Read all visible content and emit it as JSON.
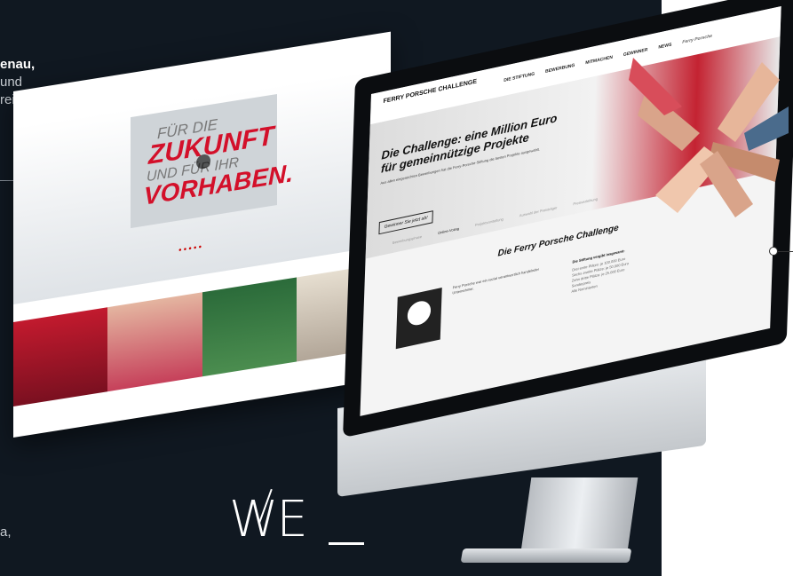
{
  "left_copy": {
    "line1": "enau,",
    "line2": "und",
    "line3": "reich",
    "bottom": "a,"
  },
  "brand_mark": "WE",
  "laptop_site": {
    "video_line1": "FÜR DIE",
    "video_line2": "ZUKUNFT",
    "video_line3": "UND FÜR IHR",
    "video_line4": "VORHABEN."
  },
  "imac_site": {
    "logo": "FERRY PORSCHE CHALLENGE",
    "nav": [
      "DIE STIFTUNG",
      "BEWERBUNG",
      "MITMACHEN",
      "GEWINNER",
      "NEWS"
    ],
    "nav_right": "Ferry Porsche",
    "hero_title": "Die Challenge: eine Million Euro für gemeinnützige Projekte",
    "hero_text": "Aus allen eingereichten Bewerbungen hat die Ferry-Porsche-Stiftung die besten Projekte ausgewählt.",
    "hero_button": "Gewinner Sie jetzt ab!",
    "tabs": [
      "Bewerbungsphase",
      "Online-Voting",
      "Projektvorstellung",
      "Auswahl der Preisträger",
      "Preisverleihung"
    ],
    "section_title": "Die Ferry Porsche Challenge",
    "body_text": "Ferry Porsche war ein sozial verantwortlich handelnder Unternehmer.",
    "list_title": "Die Stiftung vergibt insgesamt:",
    "list": [
      "Drei erste Plätze: je 100.000 Euro",
      "Sechs zweite Plätze: je 50.000 Euro",
      "Zehn dritte Plätze: je 25.000 Euro",
      "Sonderpreis",
      "Alle Nominierten"
    ]
  },
  "colors": {
    "background": "#101821",
    "accent": "#d3102a"
  }
}
